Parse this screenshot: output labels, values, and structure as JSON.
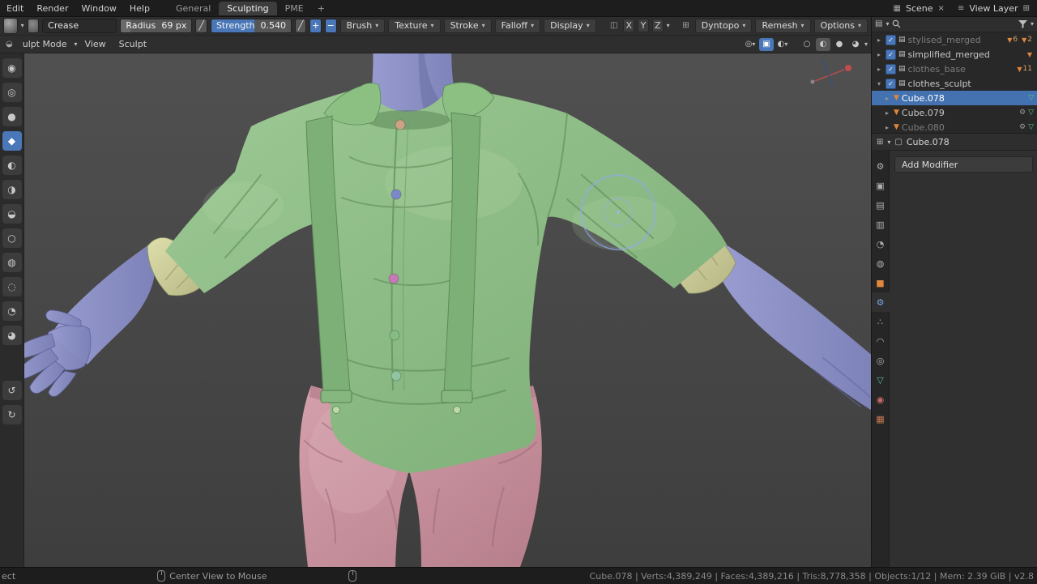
{
  "colors": {
    "accent": "#4a77b8",
    "selection": "#4472b0",
    "cursor": "#93a9f2",
    "skin": "#8d92c7",
    "shirt": "#8fbf88",
    "cuff": "#d6d79e",
    "pants": "#c9909c"
  },
  "icons": {
    "caret": "▾",
    "arrow_right": "▸",
    "arrow_down": "▾",
    "check": "✓",
    "close": "×",
    "collection": "▤",
    "mesh_orange": "▼",
    "mesh_data": "▽",
    "modifier_gear": "⚙",
    "scene": "▦",
    "view_layer": "≡",
    "copy": "⊞",
    "pressure": "╱",
    "mirror": "◫",
    "grid": "⊞",
    "eye": "◎",
    "overlay": "◐",
    "xray": "▣",
    "shade_wire": "○",
    "shade_solid": "◐",
    "shade_material": "●",
    "shade_rendered": "◕",
    "mode": "◒",
    "cube": "▢"
  },
  "topbar": {
    "menus": [
      "Edit",
      "Render",
      "Window",
      "Help"
    ],
    "workspaces": [
      "General",
      "Sculpting",
      "PME"
    ],
    "active_workspace": "Sculpting",
    "new_workspace_label": "+",
    "scene_label": "Scene",
    "view_layer_label": "View Layer"
  },
  "tool_header": {
    "brush_name": "Crease",
    "radius_label": "Radius",
    "radius_value": "69 px",
    "strength_label": "Strength",
    "strength_value": "0.540",
    "plus_label": "+",
    "minus_label": "−",
    "panels": [
      "Brush",
      "Texture",
      "Stroke",
      "Falloff",
      "Display"
    ],
    "mirror_axes": [
      "X",
      "Y",
      "Z"
    ],
    "right_panels": [
      "Dyntopo",
      "Remesh",
      "Options"
    ]
  },
  "viewport_header": {
    "mode_label": "ulpt Mode",
    "menus": [
      "View",
      "Sculpt"
    ]
  },
  "left_toolbar": {
    "tools": [
      {
        "name": "draw",
        "glyph": "◉"
      },
      {
        "name": "draw-sharp",
        "glyph": "◎"
      },
      {
        "name": "clay",
        "glyph": "●"
      },
      {
        "name": "crease",
        "glyph": "◆",
        "active": true
      },
      {
        "name": "clay-strips",
        "glyph": "◐"
      },
      {
        "name": "inflate",
        "glyph": "◑"
      },
      {
        "name": "blob",
        "glyph": "◒"
      },
      {
        "name": "smooth",
        "glyph": "○"
      },
      {
        "name": "flatten",
        "glyph": "◍"
      },
      {
        "name": "scrape",
        "glyph": "◌"
      },
      {
        "name": "pinch",
        "glyph": "◔"
      },
      {
        "name": "grab",
        "glyph": "◕"
      },
      {
        "name": "annotate",
        "glyph": "↺"
      },
      {
        "name": "measure",
        "glyph": "↻"
      }
    ]
  },
  "outliner": {
    "rows": [
      {
        "name": "stylised_merged"
      },
      {
        "name": "simplified_merged"
      },
      {
        "name": "clothes_base"
      },
      {
        "name": "clothes_sculpt"
      },
      {
        "name": "Cube.078"
      },
      {
        "name": "Cube.079"
      },
      {
        "name": "Cube.080"
      }
    ],
    "badges": {
      "stylised_merged": [
        "6",
        "2"
      ],
      "clothes_base": [
        "11"
      ]
    }
  },
  "properties": {
    "breadcrumb": "Cube.078",
    "add_modifier_label": "Add Modifier",
    "tabs": [
      {
        "name": "tool",
        "glyph": "⚙"
      },
      {
        "name": "render",
        "glyph": "▣"
      },
      {
        "name": "output",
        "glyph": "▤"
      },
      {
        "name": "view-layer",
        "glyph": "▥"
      },
      {
        "name": "scene",
        "glyph": "◔"
      },
      {
        "name": "world",
        "glyph": "◍"
      },
      {
        "name": "object",
        "glyph": "■"
      },
      {
        "name": "modifiers",
        "glyph": "⚙",
        "active": true
      },
      {
        "name": "particles",
        "glyph": "∴"
      },
      {
        "name": "physics",
        "glyph": "◠"
      },
      {
        "name": "constraints",
        "glyph": "◎"
      },
      {
        "name": "object-data",
        "glyph": "▽"
      },
      {
        "name": "material",
        "glyph": "◉"
      },
      {
        "name": "texture",
        "glyph": "▦"
      }
    ]
  },
  "statusbar": {
    "left_label": "ect",
    "center_label": "Center View to Mouse",
    "stats": "Cube.078 | Verts:4,389,249 | Faces:4,389,216 | Tris:8,778,358 | Objects:1/12 | Mem: 2.39 GiB | v2.8"
  }
}
